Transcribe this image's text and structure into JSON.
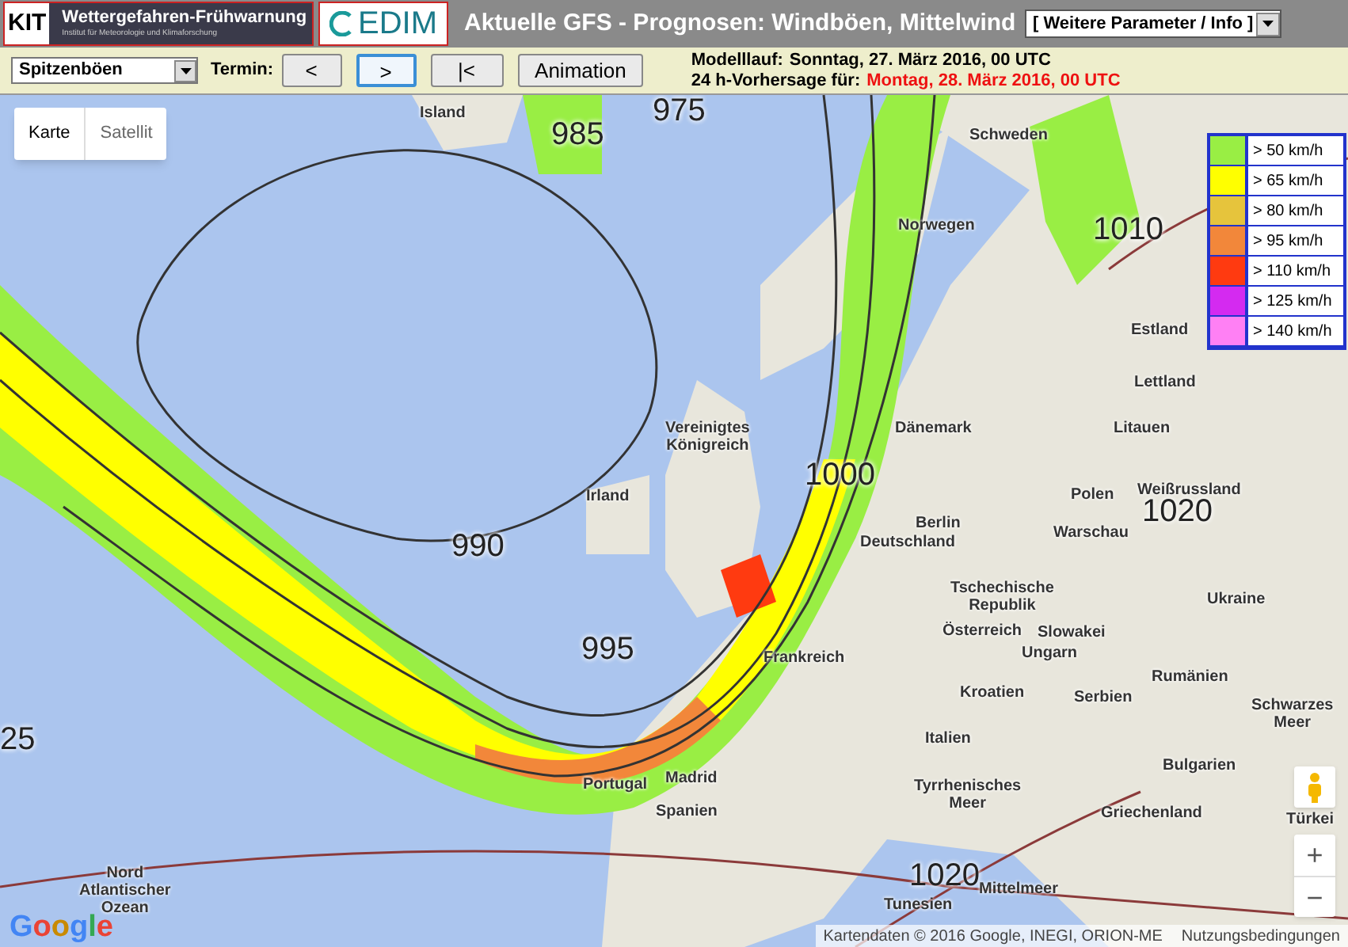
{
  "header": {
    "logo_kit": "KIT",
    "logo_banner": "Wettergefahren-Frühwarnung",
    "logo_banner_sub": "Institut für Meteorologie und Klimaforschung",
    "logo_cedim": "EDIM",
    "title": "Aktuelle GFS - Prognosen: Windböen, Mittelwind",
    "parameter_select": "[ Weitere Parameter / Info ]"
  },
  "toolbar": {
    "variable_select": "Spitzenböen",
    "termin_label": "Termin:",
    "buttons": [
      {
        "label": "<",
        "selected": false
      },
      {
        "label": ">",
        "selected": true
      },
      {
        "label": "|<",
        "selected": false
      },
      {
        "label": "Animation",
        "selected": false
      }
    ],
    "run_label": "Modelllauf:",
    "run_value": "Sonntag, 27. März 2016, 00 UTC",
    "forecast_label": "24 h-Vorhersage für:",
    "forecast_value": "Montag, 28. März 2016, 00 UTC"
  },
  "map": {
    "type_tabs": [
      {
        "label": "Karte",
        "selected": true
      },
      {
        "label": "Satellit",
        "selected": false
      }
    ],
    "labels": [
      {
        "text": "Island",
        "kind": "place"
      },
      {
        "text": "Schweden",
        "kind": "place"
      },
      {
        "text": "Norwegen",
        "kind": "place"
      },
      {
        "text": "Estland",
        "kind": "place"
      },
      {
        "text": "Lettland",
        "kind": "place"
      },
      {
        "text": "Vereinigtes Königreich",
        "kind": "place"
      },
      {
        "text": "Dänemark",
        "kind": "place"
      },
      {
        "text": "Litauen",
        "kind": "place"
      },
      {
        "text": "Irland",
        "kind": "place"
      },
      {
        "text": "Polen",
        "kind": "place"
      },
      {
        "text": "Weißrussland",
        "kind": "place"
      },
      {
        "text": "Berlin",
        "kind": "place"
      },
      {
        "text": "Deutschland",
        "kind": "place"
      },
      {
        "text": "Warschau",
        "kind": "place"
      },
      {
        "text": "Tschechische Republik",
        "kind": "place"
      },
      {
        "text": "Slowakei",
        "kind": "place"
      },
      {
        "text": "Ukraine",
        "kind": "place"
      },
      {
        "text": "Österreich",
        "kind": "place"
      },
      {
        "text": "Frankreich",
        "kind": "place"
      },
      {
        "text": "Ungarn",
        "kind": "place"
      },
      {
        "text": "Kroatien",
        "kind": "place"
      },
      {
        "text": "Rumänien",
        "kind": "place"
      },
      {
        "text": "Serbien",
        "kind": "place"
      },
      {
        "text": "Schwarzes Meer",
        "kind": "place"
      },
      {
        "text": "Italien",
        "kind": "place"
      },
      {
        "text": "Bulgarien",
        "kind": "place"
      },
      {
        "text": "Portugal",
        "kind": "place"
      },
      {
        "text": "Madrid",
        "kind": "place"
      },
      {
        "text": "Spanien",
        "kind": "place"
      },
      {
        "text": "Tyrrhenisches Meer",
        "kind": "place"
      },
      {
        "text": "Griechenland",
        "kind": "place"
      },
      {
        "text": "Türkei",
        "kind": "place"
      },
      {
        "text": "Tunesien",
        "kind": "place"
      },
      {
        "text": "Mittelmeer",
        "kind": "place"
      },
      {
        "text": "Nord Atlantischer Ozean",
        "kind": "place"
      },
      {
        "text": "990",
        "kind": "isobar"
      },
      {
        "text": "995",
        "kind": "isobar"
      },
      {
        "text": "1000",
        "kind": "isobar"
      },
      {
        "text": "1010",
        "kind": "isobar"
      },
      {
        "text": "1020",
        "kind": "isobar"
      },
      {
        "text": "1020",
        "kind": "isobar"
      },
      {
        "text": "985",
        "kind": "isobar"
      },
      {
        "text": "975",
        "kind": "isobar"
      },
      {
        "text": "25",
        "kind": "isobar"
      }
    ],
    "legend": [
      {
        "label": "> 50 km/h",
        "color": "#99ee44"
      },
      {
        "label": "> 65 km/h",
        "color": "#ffff00"
      },
      {
        "label": "> 80 km/h",
        "color": "#e6c43c"
      },
      {
        "label": "> 95 km/h",
        "color": "#f2873a"
      },
      {
        "label": "> 110 km/h",
        "color": "#ff3a10"
      },
      {
        "label": "> 125 km/h",
        "color": "#d42af0"
      },
      {
        "label": "> 140 km/h",
        "color": "#ff80f4"
      }
    ],
    "google_logo": "Google",
    "attribution": "Kartendaten © 2016 Google, INEGI, ORION-ME",
    "terms_link": "Nutzungsbedingungen",
    "zoom_in": "+",
    "zoom_out": "−"
  }
}
